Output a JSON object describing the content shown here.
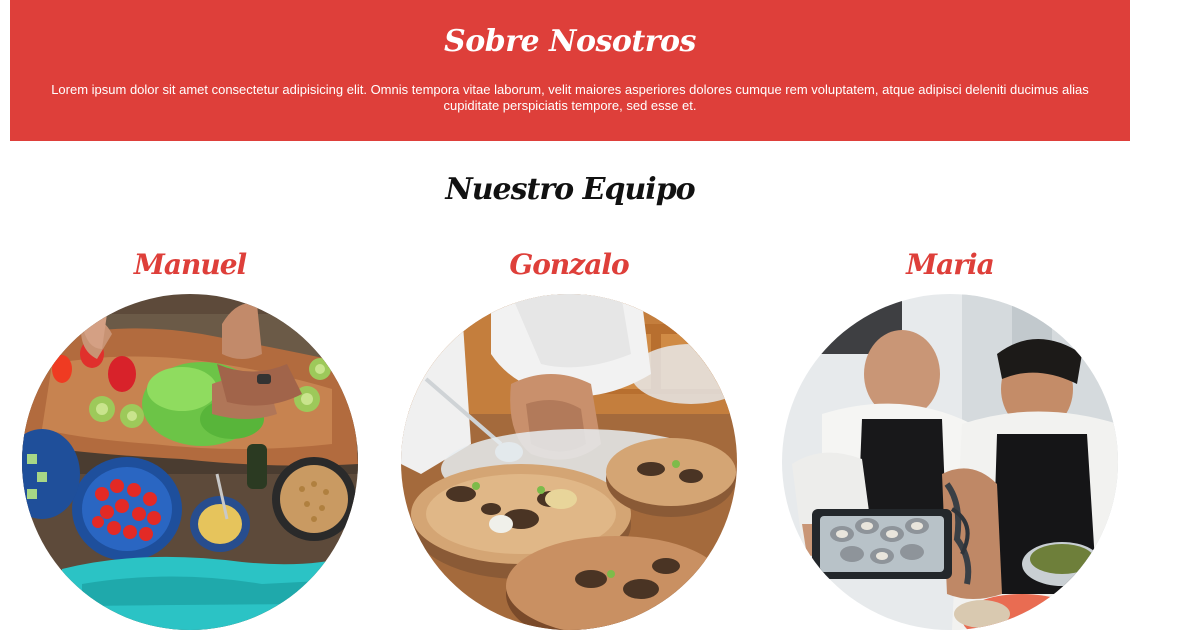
{
  "about": {
    "title": "Sobre Nosotros",
    "text": "Lorem ipsum dolor sit amet consectetur adipisicing elit. Omnis tempora vitae laborum, velit maiores asperiores dolores cumque rem voluptatem, atque adipisci deleniti ducimus alias cupiditate perspiciatis tempore, sed esse et."
  },
  "team": {
    "title": "Nuestro Equipo",
    "members": [
      {
        "name": "Manuel",
        "photo": "vegetables-prep-photo"
      },
      {
        "name": "Gonzalo",
        "photo": "plating-dishes-photo"
      },
      {
        "name": "Maria",
        "photo": "chefs-oysters-photo"
      }
    ]
  },
  "colors": {
    "accent": "#de3f3a",
    "heading": "#111111",
    "background": "#ffffff"
  }
}
